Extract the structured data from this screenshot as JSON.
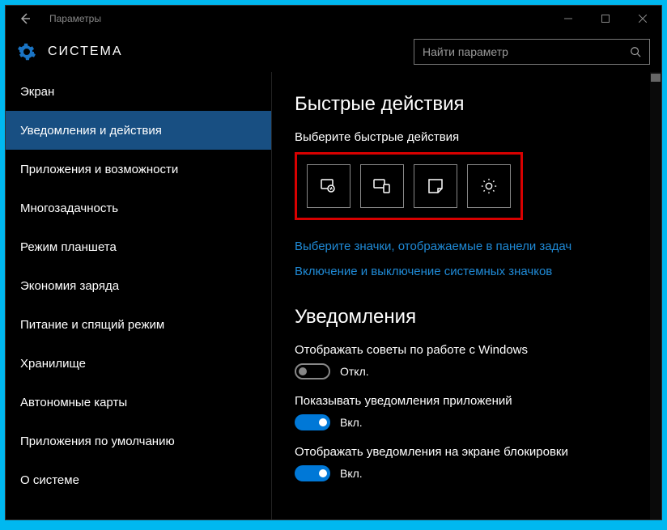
{
  "titlebar": {
    "app_name": "Параметры"
  },
  "header": {
    "title": "СИСТЕМА",
    "search_placeholder": "Найти параметр"
  },
  "sidebar": {
    "items": [
      {
        "label": "Экран"
      },
      {
        "label": "Уведомления и действия"
      },
      {
        "label": "Приложения и возможности"
      },
      {
        "label": "Многозадачность"
      },
      {
        "label": "Режим планшета"
      },
      {
        "label": "Экономия заряда"
      },
      {
        "label": "Питание и спящий режим"
      },
      {
        "label": "Хранилище"
      },
      {
        "label": "Автономные карты"
      },
      {
        "label": "Приложения по умолчанию"
      },
      {
        "label": "О системе"
      }
    ],
    "active_index": 1
  },
  "content": {
    "quick_actions": {
      "heading": "Быстрые действия",
      "choose_label": "Выберите быстрые действия",
      "tiles": [
        "tablet-mode",
        "connect",
        "note",
        "settings"
      ]
    },
    "links": {
      "taskbar_icons": "Выберите значки, отображаемые в панели задач",
      "system_icons": "Включение и выключение системных значков"
    },
    "notifications": {
      "heading": "Уведомления",
      "items": [
        {
          "label": "Отображать советы по работе с Windows",
          "on": false,
          "state_text": "Откл."
        },
        {
          "label": "Показывать уведомления приложений",
          "on": true,
          "state_text": "Вкл."
        },
        {
          "label": "Отображать уведомления на экране блокировки",
          "on": true,
          "state_text": "Вкл."
        }
      ]
    }
  }
}
